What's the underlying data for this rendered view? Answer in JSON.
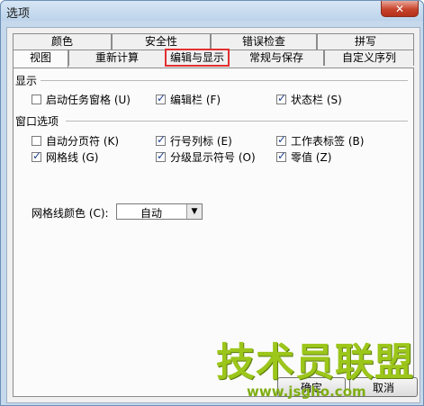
{
  "window": {
    "title": "选项",
    "close_glyph": "✕"
  },
  "tabs_back": [
    {
      "label": "颜色"
    },
    {
      "label": "安全性"
    },
    {
      "label": "错误检查"
    },
    {
      "label": "拼写"
    }
  ],
  "tabs_front": [
    {
      "label": "视图"
    },
    {
      "label": "重新计算"
    },
    {
      "label": "编辑与显示"
    },
    {
      "label": "常规与保存"
    },
    {
      "label": "自定义序列"
    }
  ],
  "active_tab": "视图",
  "highlighted_tab": "编辑与显示",
  "highlight_color": "#e23030",
  "display_section": {
    "title": "显示",
    "options": [
      {
        "label": "启动任务窗格 (U)",
        "checked": false
      },
      {
        "label": "编辑栏 (F)",
        "checked": true
      },
      {
        "label": "状态栏 (S)",
        "checked": true
      }
    ]
  },
  "window_section": {
    "title": "窗口选项",
    "options": [
      {
        "label": "自动分页符 (K)",
        "checked": false
      },
      {
        "label": "行号列标 (E)",
        "checked": true
      },
      {
        "label": "工作表标签 (B)",
        "checked": true
      },
      {
        "label": "网格线 (G)",
        "checked": true
      },
      {
        "label": "分级显示符号 (O)",
        "checked": true
      },
      {
        "label": "零值 (Z)",
        "checked": true
      }
    ]
  },
  "gridline_color": {
    "label": "网格线颜色 (C):",
    "value": "自动"
  },
  "buttons": {
    "ok": "确定",
    "cancel": "取消"
  },
  "watermark": {
    "title": "技术员联盟",
    "url": "www.jsgho.com"
  }
}
